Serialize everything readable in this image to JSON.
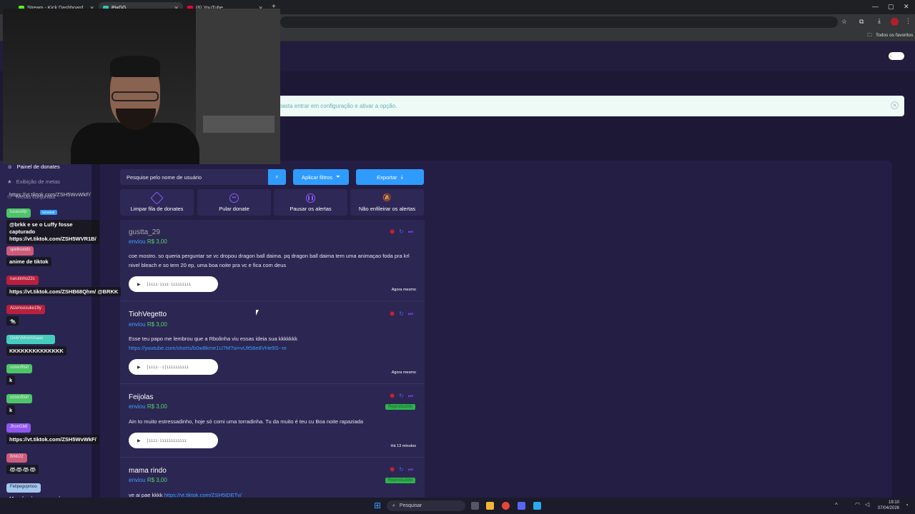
{
  "browser": {
    "tabs": [
      {
        "title": "Stream - Kick Dashboard",
        "fav_color": "#53fc18"
      },
      {
        "title": "PixGG",
        "fav_color": "#2ec4b6"
      },
      {
        "title": "(6) YouTube",
        "fav_color": "#ff0033"
      }
    ],
    "bookmarks_label": "Todos os favoritos"
  },
  "banner": {
    "text": "basta entrar em configuração e ativar a opção."
  },
  "sidebar": {
    "items": [
      {
        "label": "Painel de donates",
        "icon": "donate-icon"
      },
      {
        "label": "Exibição de metas",
        "icon": "star-icon"
      },
      {
        "label": "Metas conjuntas",
        "icon": "group-icon"
      }
    ]
  },
  "toolbar": {
    "search_placeholder": "Pesquise pelo nome de usuário",
    "apply_filters": "Aplicar filtros",
    "export": "Exportar"
  },
  "actions": [
    {
      "label": "Limpar fila de donates",
      "icon": "eraser-icon"
    },
    {
      "label": "Pular donate",
      "icon": "skip-icon"
    },
    {
      "label": "Pausar os alertas",
      "icon": "pause-icon"
    },
    {
      "label": "Não enfileirar os alertas",
      "icon": "bell-off-icon"
    }
  ],
  "donations": [
    {
      "name": "gustta_29",
      "sent": "enviou",
      "amount": "R$ 3,00",
      "message": "coe mostro. so queria perguntar se vc dropou dragon ball daima. pq dragon ball daima tem uma animaçao foda pra krl nivel bleach e so tem 20 ep, uma boa noite pra vc e fica com deus",
      "link": "",
      "time": "Agora mesmo",
      "status": ""
    },
    {
      "name": "TiohVegetto",
      "sent": "enviou",
      "amount": "R$ 3,00",
      "message": "Esse teu papo me lembrou que a Rbolinha viu essas ideia sua kkkkkkk",
      "link": "https://youtube.com/shorts/b0w8kme1U7M?si=vUlt56e8VHe9S--m",
      "time": "Agora mesmo",
      "status": ""
    },
    {
      "name": "Feijolas",
      "sent": "enviou",
      "amount": "R$ 3,00",
      "message": "Ain to muito estressadinho, hoje só comi uma torradinha. Tu da muito é teu cu Boa noite rapaziada",
      "link": "",
      "time": "Há 13 minutos",
      "status": "Reproduzido"
    },
    {
      "name": "mama rindo",
      "sent": "enviou",
      "amount": "R$ 3,00",
      "message": "ve ai pae kkkk",
      "link": "https://vt.tiktok.com/ZSH5tDETv/",
      "time": "",
      "status": "Reproduzido"
    }
  ],
  "chat": [
    {
      "user": "",
      "msg": "https://vt.tiktok.com/ZSH5WvWkF/",
      "color": "#333"
    },
    {
      "user": "lucasxdp",
      "msg": "@brkk e se o Luffy fosse capturado https://vt.tiktok.com/ZSH5WVR1B/",
      "color": "#53d66b",
      "badge": "NEWBIE"
    },
    {
      "user": "spellsoods",
      "msg": "anime de tiktok",
      "color": "#e0627f"
    },
    {
      "user": "narutinho22c",
      "msg": "https://vt.tiktok.com/ZSHB68Qhm/ @BRKK",
      "color": "#c9203b"
    },
    {
      "user": "Aizensosuke19y",
      "msg": "🐀",
      "color": "#c9203b"
    },
    {
      "user": "OxbrVehemmaas",
      "msg": "KKKKKKKKKKKKKK",
      "color": "#48e0c8"
    },
    {
      "user": "oorenftlsh",
      "msg": "k",
      "color": "#53d66b"
    },
    {
      "user": "oorenftlsh",
      "msg": "k",
      "color": "#53d66b"
    },
    {
      "user": "JhonGb8",
      "msg": "https://vt.tiktok.com/ZSH5WvWkF/",
      "color": "#9b5cff"
    },
    {
      "user": "Brkk22",
      "msg": "🦝🦝🦝🦝",
      "color": "#e0627f"
    },
    {
      "user": "Felipegvpmoo",
      "msg": "Mas é ruim, nem veja",
      "color": "#b0d8ff"
    }
  ],
  "taskbar": {
    "search": "Pesquisar",
    "time": "19:10",
    "date": "07/04/2026"
  }
}
